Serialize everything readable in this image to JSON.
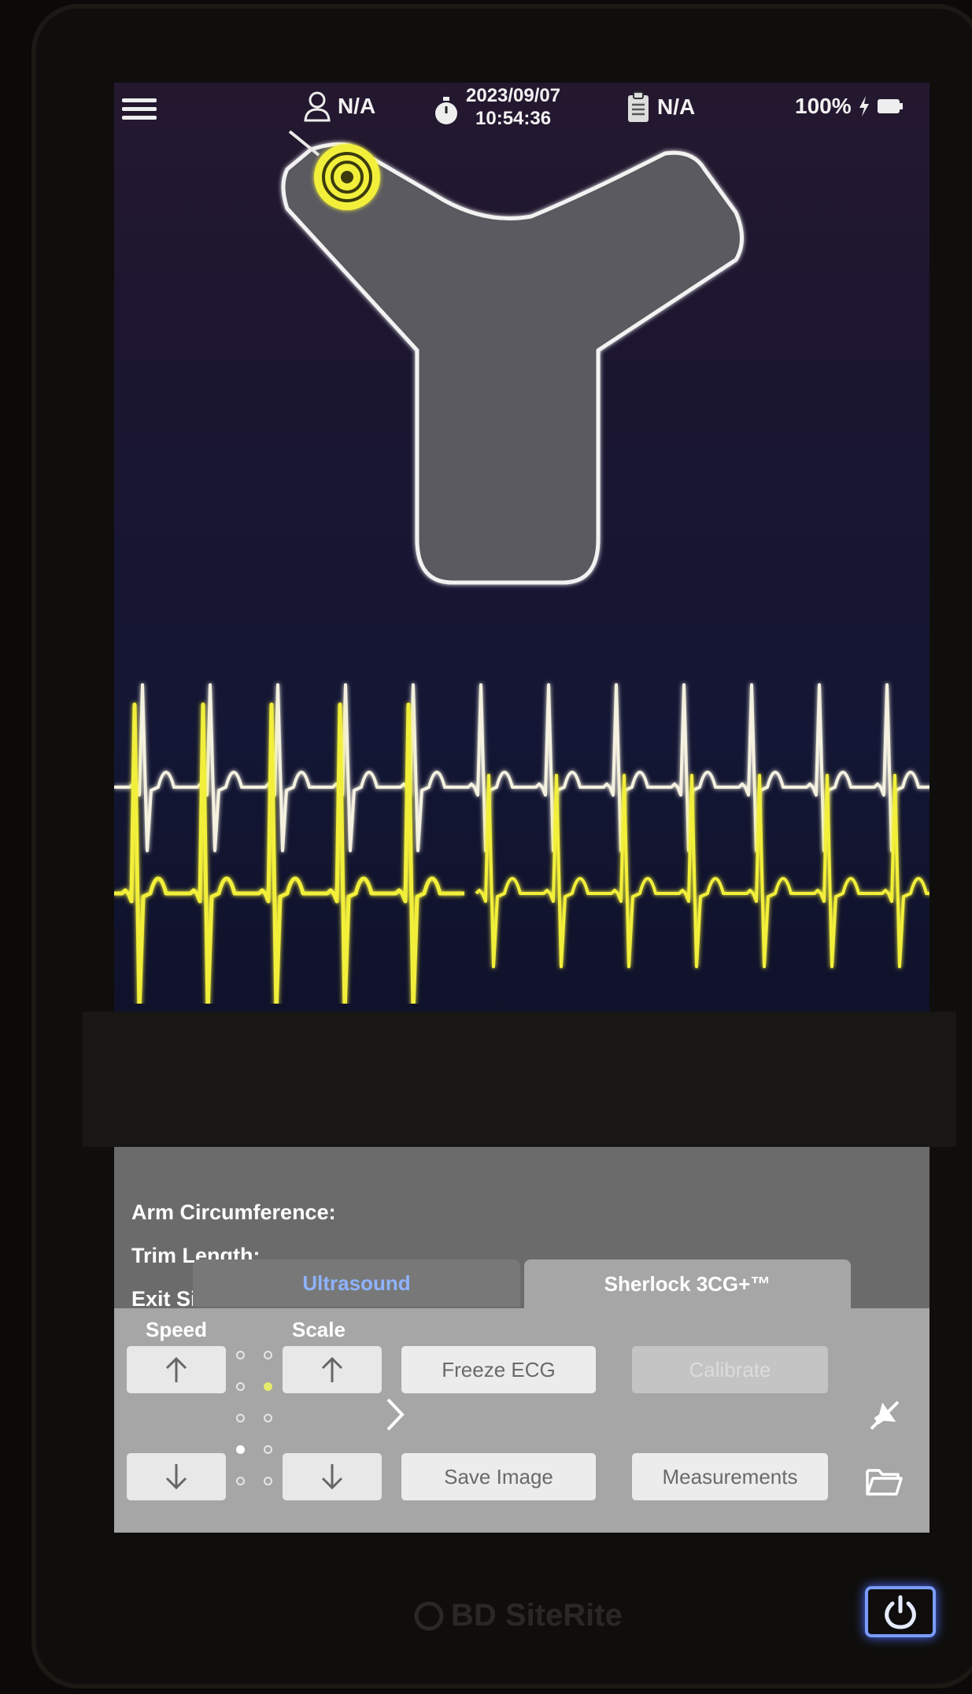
{
  "status_bar": {
    "patient_id": "N/A",
    "date": "2023/09/07",
    "time": "10:54:36",
    "record_id": "N/A",
    "battery": "100%"
  },
  "info": {
    "partial_label": "Arm Circumference:",
    "trim_length_label": "Trim Length:",
    "exit_site_label": "Exit Site:"
  },
  "tabs": {
    "ultrasound": "Ultrasound",
    "sherlock": "Sherlock 3CG+™",
    "active": "sherlock"
  },
  "controls": {
    "speed_label": "Speed",
    "scale_label": "Scale",
    "freeze_ecg": "Freeze ECG",
    "calibrate": "Calibrate",
    "save_image": "Save Image",
    "measurements": "Measurements"
  },
  "device": {
    "brand": "BD SiteRite"
  },
  "colors": {
    "ecg_yellow": "#f2ef3a",
    "ecg_white": "#f4f1e0",
    "power_blue": "#7a9cff",
    "tab_link_blue": "#8fb3ff"
  },
  "icons": [
    "menu-icon",
    "user-icon",
    "stopwatch-icon",
    "clipboard-icon",
    "lightning-icon",
    "battery-icon",
    "target-icon",
    "arrow-up-icon",
    "arrow-down-icon",
    "chevron-right-icon",
    "mute-icon",
    "folder-icon",
    "power-icon"
  ]
}
